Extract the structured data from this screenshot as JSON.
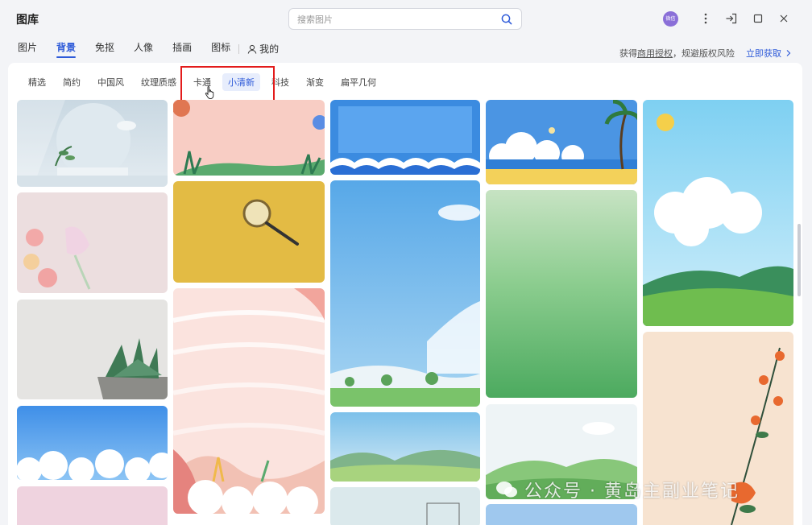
{
  "app": {
    "title": "图库"
  },
  "search": {
    "placeholder": "搜索图片"
  },
  "avatar": {
    "label": "微信"
  },
  "main_tabs": [
    {
      "label": "图片",
      "active": false
    },
    {
      "label": "背景",
      "active": true
    },
    {
      "label": "免抠",
      "active": false
    },
    {
      "label": "人像",
      "active": false
    },
    {
      "label": "插画",
      "active": false
    },
    {
      "label": "图标",
      "active": false
    },
    {
      "label": "我的",
      "active": false
    }
  ],
  "license": {
    "prefix": "获得",
    "link": "商用授权",
    "suffix": "，规避版权风险",
    "action": "立即获取"
  },
  "categories": [
    {
      "label": "精选",
      "active": false
    },
    {
      "label": "简约",
      "active": false
    },
    {
      "label": "中国风",
      "active": false
    },
    {
      "label": "纹理质感",
      "active": false
    },
    {
      "label": "卡通",
      "active": false
    },
    {
      "label": "小清新",
      "active": true
    },
    {
      "label": "科技",
      "active": false
    },
    {
      "label": "渐变",
      "active": false
    },
    {
      "label": "扁平几何",
      "active": false
    }
  ],
  "watermark": {
    "text": "公众号 · 黄岛主副业笔记"
  },
  "colors": {
    "accent": "#2f5bd9",
    "highlight": "#e31b1b"
  }
}
